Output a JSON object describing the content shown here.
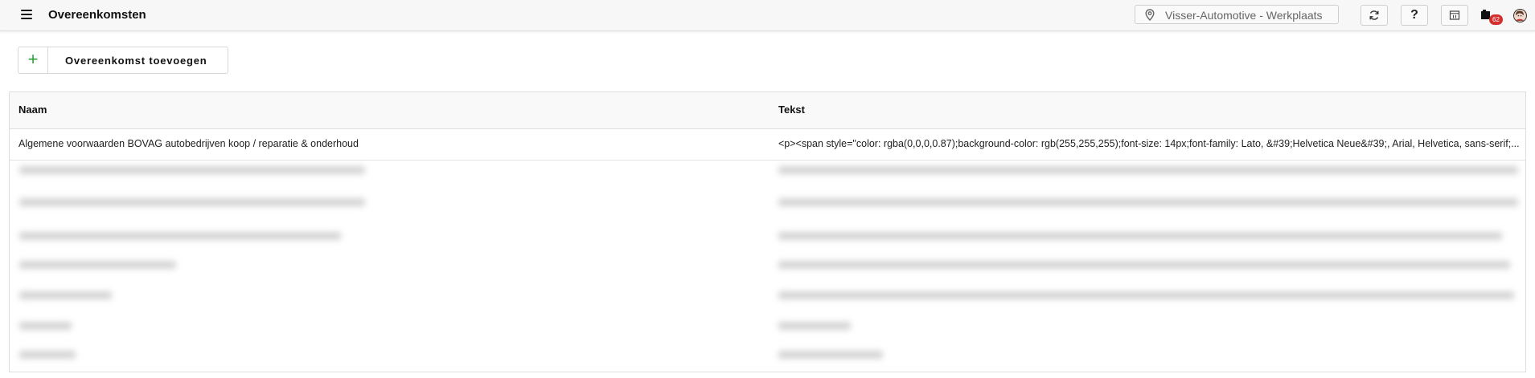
{
  "header": {
    "title": "Overeenkomsten",
    "location": "Visser-Automotive - Werkplaats",
    "help_label": "?",
    "notification_count": "62"
  },
  "toolbar": {
    "add_label": "Overeenkomst toevoegen",
    "add_symbol": "+"
  },
  "table": {
    "columns": [
      "Naam",
      "Tekst"
    ],
    "rows": [
      {
        "naam": "Algemene voorwaarden BOVAG autobedrijven koop / reparatie & onderhoud",
        "tekst": "<p><span style=\"color: rgba(0,0,0,0.87);background-color: rgb(255,255,255);font-size: 14px;font-family: Lato, &#39;Helvetica Neue&#39;, Arial, Helvetica, sans-serif;..."
      }
    ]
  },
  "icons": {
    "menu": "hamburger-icon",
    "location": "map-pin-icon",
    "refresh": "refresh-icon",
    "help": "question-icon",
    "calendar": "calendar-icon",
    "notifications": "inbox-icon",
    "user": "avatar-icon"
  },
  "colors": {
    "accent_green": "#2e9d3a",
    "badge_red": "#d32f2f",
    "topbar_bg": "#f7f7f8"
  }
}
